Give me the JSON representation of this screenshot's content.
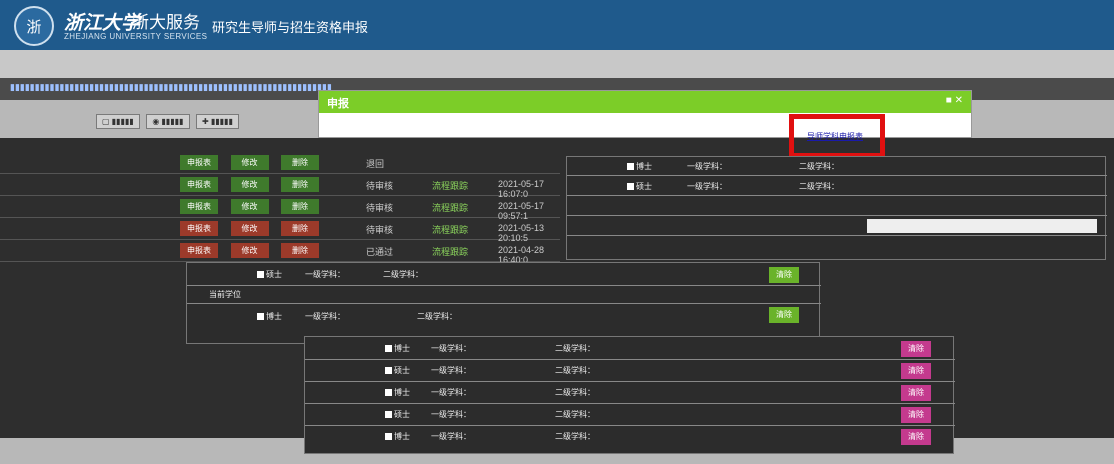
{
  "header": {
    "logo_cn": "浙江大学",
    "service": "浙大服务",
    "logo_en": "ZHEJIANG UNIVERSITY SERVICES",
    "app_title": "研究生导师与招生资格申报"
  },
  "table": {
    "rows": [
      {
        "c1": "申报表",
        "c2": "修改",
        "c3": "删除",
        "status": "退回",
        "process": "",
        "date": ""
      },
      {
        "c1": "申报表",
        "c2": "修改",
        "c3": "删除",
        "status": "待审核",
        "process": "流程跟踪",
        "date": "2021-05-17 16:07:0"
      },
      {
        "c1": "申报表",
        "c2": "修改",
        "c3": "删除",
        "status": "待审核",
        "process": "流程跟踪",
        "date": "2021-05-17 09:57:1"
      },
      {
        "c1": "申报表",
        "c2": "修改",
        "c3": "删除",
        "status": "待审核",
        "process": "流程跟踪",
        "date": "2021-05-13 20:10:5"
      },
      {
        "c1": "申报表",
        "c2": "修改",
        "c3": "删除",
        "status": "已通过",
        "process": "流程跟踪",
        "date": "2021-04-28 16:40:0"
      }
    ]
  },
  "dialog": {
    "title": "申报",
    "link": "导师学科申报表"
  },
  "panel": {
    "qualified": "当前学位",
    "clear": "清除",
    "rows": [
      {
        "cat": "博士",
        "a": "一级学科：",
        "b": "二级学科："
      },
      {
        "cat": "硕士",
        "a": "一级学科：",
        "b": "二级学科："
      }
    ]
  }
}
